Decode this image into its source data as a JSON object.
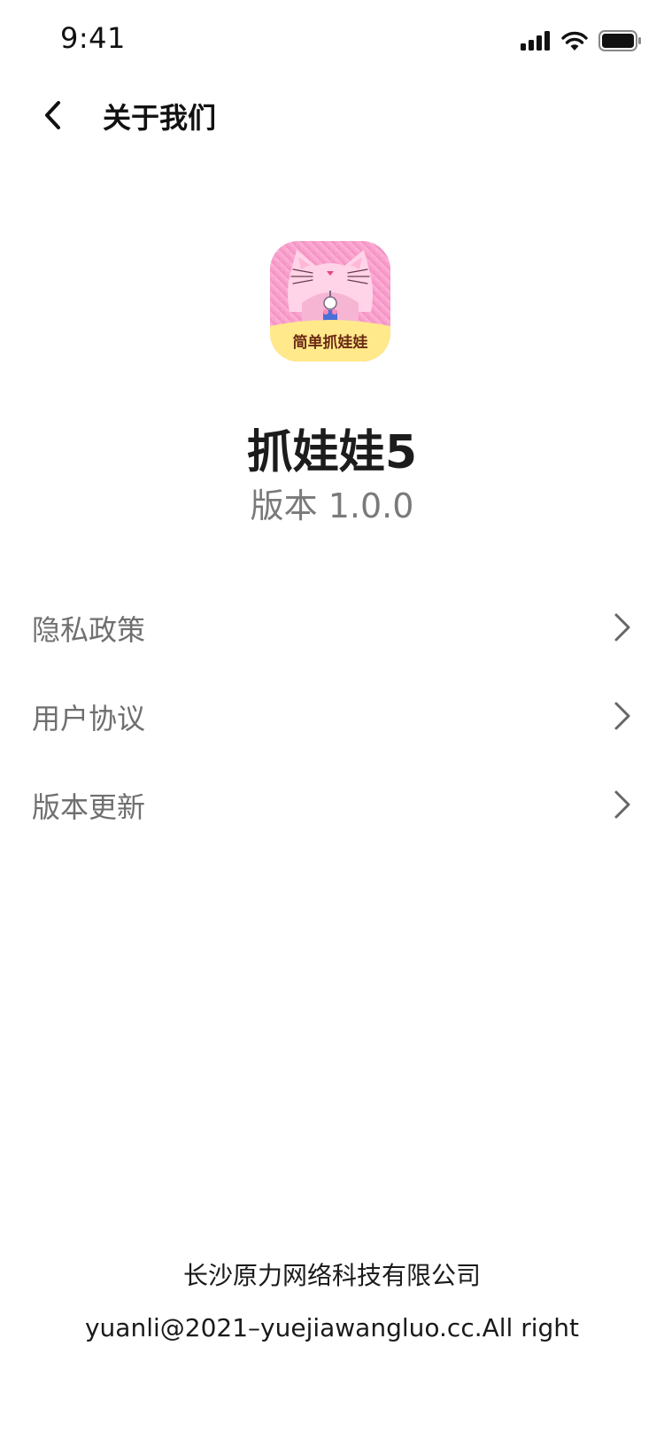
{
  "status_bar": {
    "time": "9:41",
    "icons": [
      "cellular-signal-icon",
      "wifi-icon",
      "battery-icon"
    ]
  },
  "nav": {
    "title": "关于我们",
    "back_icon": "chevron-left-icon"
  },
  "app": {
    "icon_caption": "简单抓娃娃",
    "name": "抓娃娃5",
    "version": "版本 1.0.0",
    "icon_colors": {
      "top": "#f7a8cf",
      "bottom": "#ffe58f",
      "caption_text": "#6b2a15"
    }
  },
  "menu": {
    "items": [
      {
        "label": "隐私政策",
        "icon": "chevron-right-icon"
      },
      {
        "label": "用户协议",
        "icon": "chevron-right-icon"
      },
      {
        "label": "版本更新",
        "icon": "chevron-right-icon"
      }
    ]
  },
  "footer": {
    "company": "长沙原力网络科技有限公司",
    "copyright": "yuanli@2021–yuejiawangluo.cc.All right"
  }
}
